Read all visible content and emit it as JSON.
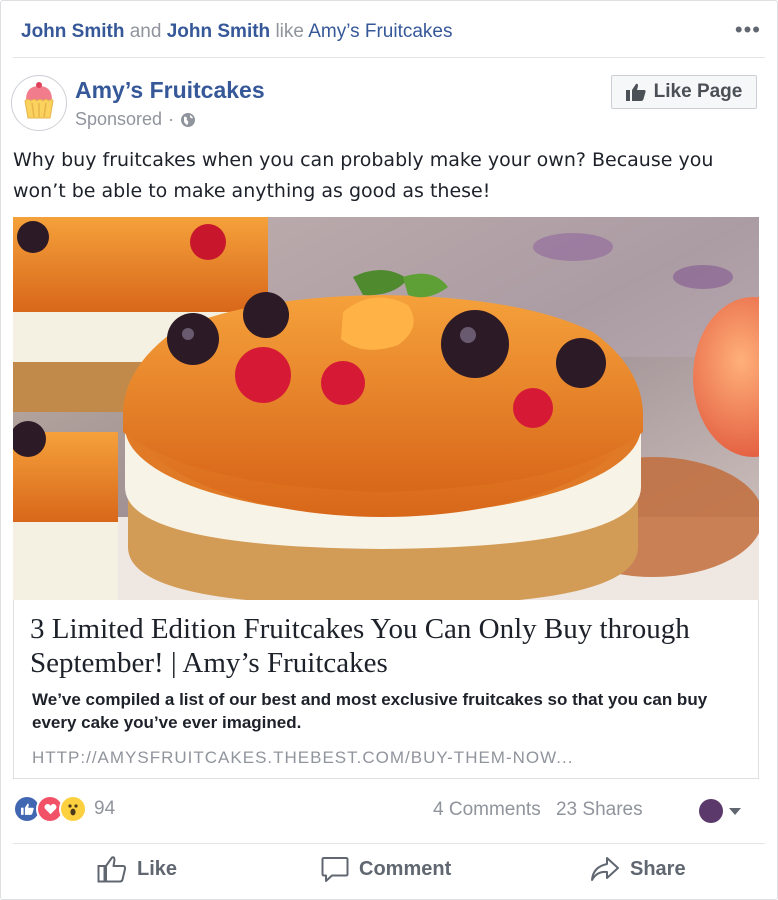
{
  "social": {
    "friend1": "John Smith",
    "connector": "and",
    "friend2": "John Smith",
    "verb": "like",
    "page": "Amy’s Fruitcakes"
  },
  "menu": {
    "more_label": "•••"
  },
  "post": {
    "page_name": "Amy’s Fruitcakes",
    "sponsored": "Sponsored",
    "separator": "·",
    "like_page_label": "Like Page",
    "text": "Why buy fruitcakes when you can probably make your own? Because you won’t be able to make anything as good as these!"
  },
  "link": {
    "title": "3 Limited Edition Fruitcakes You Can Only Buy through September! | Amy’s Fruitcakes",
    "description": "We’ve compiled a list of our best and most exclusive fruitcakes so that you can buy every cake you’ve ever imagined.",
    "url": "HTTP://AMYSFRUITCAKES.THEBEST.COM/BUY-THEM-NOW..."
  },
  "engagement": {
    "reactions_count": "94",
    "comments": "4 Comments",
    "shares": "23 Shares"
  },
  "actions": {
    "like": "Like",
    "comment": "Comment",
    "share": "Share"
  },
  "colors": {
    "brand_blue": "#365899",
    "like_blue": "#4267b2",
    "love_red": "#f25268",
    "wow_yellow": "#fcd03f",
    "muted": "#90949c"
  },
  "icons": [
    "more-options-icon",
    "cupcake-logo-icon",
    "globe-icon",
    "thumbs-up-icon",
    "like-reaction-icon",
    "love-reaction-icon",
    "wow-reaction-icon",
    "comment-icon",
    "share-icon",
    "caret-down-icon"
  ]
}
